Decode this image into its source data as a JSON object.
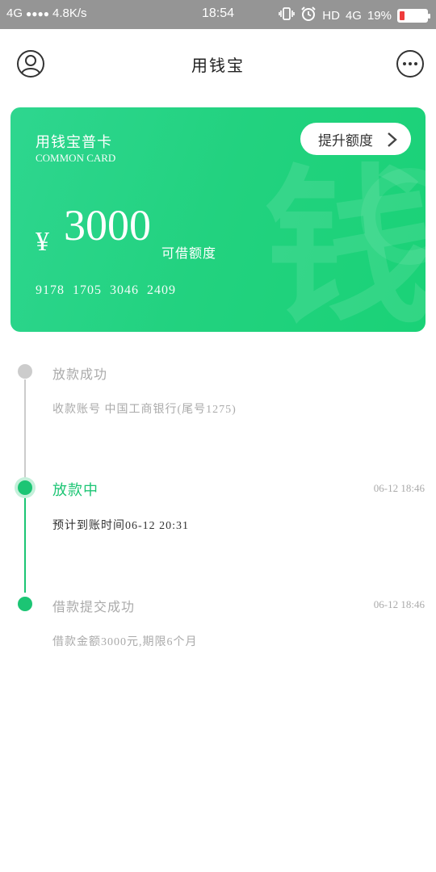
{
  "status_bar": {
    "network": "4G",
    "signal_dots": "●●●●",
    "speed": "4.8K/s",
    "time": "18:54",
    "hd": "HD",
    "network_right": "4G",
    "battery_percent": "19%",
    "battery_level": 0.19,
    "icons": [
      "vibrate-icon",
      "alarm-icon"
    ]
  },
  "header": {
    "title": "用钱宝",
    "left_icon": "user-icon",
    "right_icon": "more-icon"
  },
  "card": {
    "name": "用钱宝普卡",
    "subtitle": "COMMON CARD",
    "raise_label": "提升额度",
    "currency": "¥",
    "amount": "3000",
    "amount_label": "可借额度",
    "number": "9178 1705 3046 2409",
    "watermark": "钱",
    "color": "#22d27f"
  },
  "timeline": [
    {
      "title": "放款成功",
      "desc": "收款账号 中国工商银行(尾号1275)",
      "time": "",
      "state": "pending"
    },
    {
      "title": "放款中",
      "desc": "预计到账时间06-12 20:31",
      "time": "06-12 18:46",
      "state": "current"
    },
    {
      "title": "借款提交成功",
      "desc": "借款金额3000元,期限6个月",
      "time": "06-12 18:46",
      "state": "done"
    }
  ],
  "colors": {
    "accent": "#1cc574",
    "pending": "#cccccc",
    "text_muted": "#999999",
    "status_bar": "#959595"
  }
}
